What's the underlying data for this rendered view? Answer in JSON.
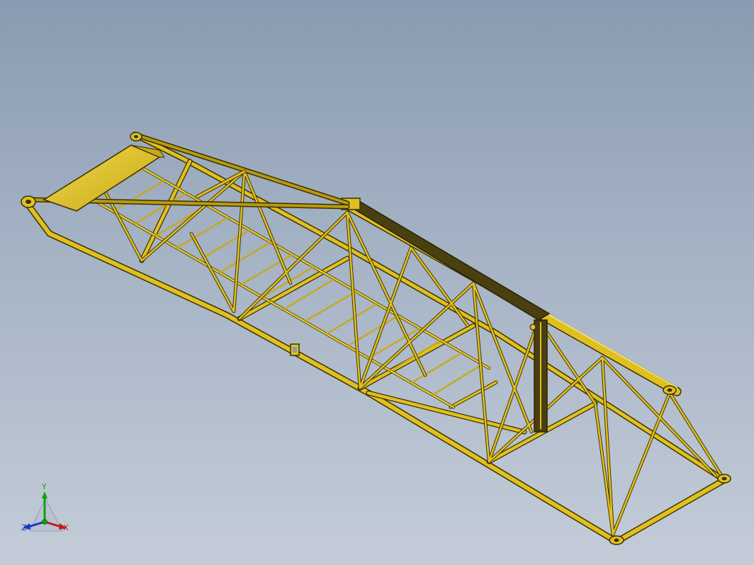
{
  "viewport": {
    "background_top": "#8a9bb1",
    "background_bottom": "#c4ccd8"
  },
  "model": {
    "part_color": "#e0c020",
    "edge_color": "#3a3000",
    "shade_color": "#a88a00",
    "dark_part_color": "#4a3f10"
  },
  "triad": {
    "x_label": "X",
    "y_label": "Y",
    "z_label": "Z",
    "x_color": "#c01818",
    "y_color": "#10a010",
    "z_color": "#1838c0",
    "x_icon": "arrow-x-icon",
    "y_icon": "arrow-y-icon",
    "z_icon": "arrow-z-icon"
  }
}
